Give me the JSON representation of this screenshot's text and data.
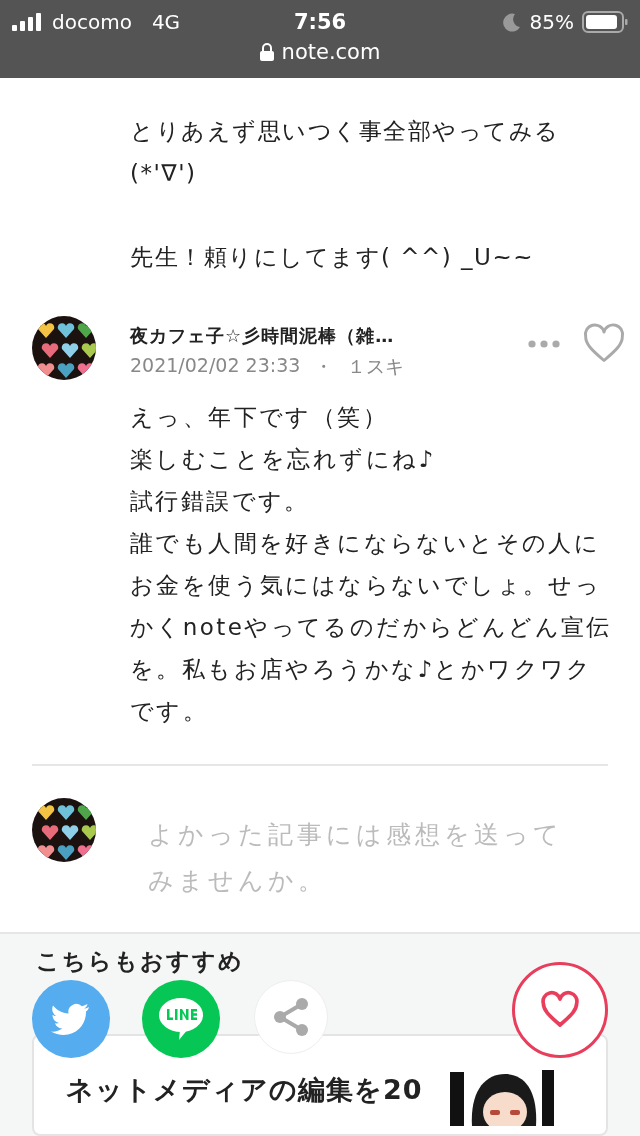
{
  "status_bar": {
    "carrier": "docomo",
    "network": "4G",
    "time": "7:56",
    "battery": "85%",
    "url": "note.com"
  },
  "parent_comment": {
    "paragraphs": [
      [
        "とりあえず思いつく事全部やってみる",
        "(*'∇')"
      ],
      [
        "先生！頼りにしてます( ^^) _U~~"
      ]
    ]
  },
  "reply": {
    "author": "夜カフェ子☆彡時間泥棒（雑…",
    "date": "2021/02/02 23:33",
    "separator": "・",
    "likes": "１スキ",
    "liked": false,
    "lines": [
      "えっ、年下です（笑）",
      "楽しむことを忘れずにね♪",
      "試行錯誤です。",
      "誰でも人間を好きにならないとその人に",
      "お金を使う気にはならないでしょ。せっ",
      "かくnoteやってるのだからどんどん宣伝",
      "を。私もお店やろうかな♪とかワクワク",
      "です。"
    ]
  },
  "comment_input": {
    "placeholder": "よかった記事には感想を送ってみませんか。"
  },
  "recommend": {
    "title": "こちらもおすすめ",
    "card_title": "ネットメディアの編集を20"
  },
  "share_bar": {
    "liked": false
  }
}
